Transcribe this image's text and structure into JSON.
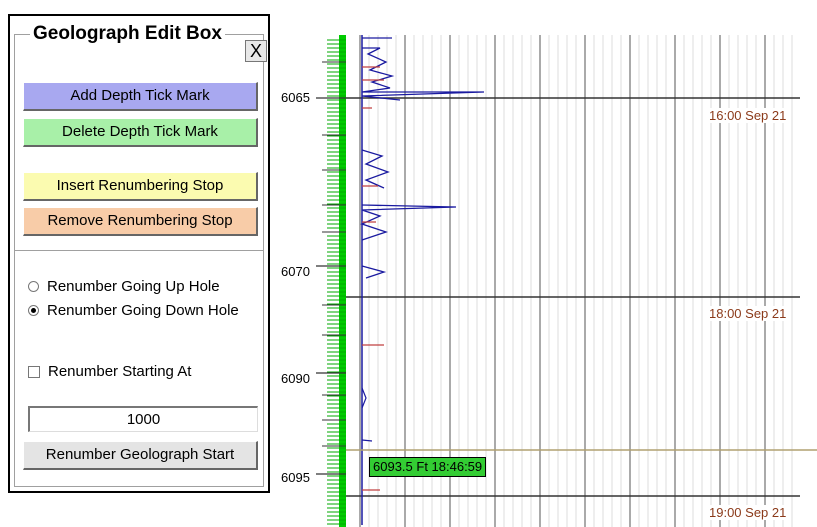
{
  "panel": {
    "title": "Geolograph Edit Box",
    "close_label": "X",
    "buttons": {
      "add_tick": "Add Depth Tick Mark",
      "delete_tick": "Delete Depth Tick Mark",
      "insert_stop": "Insert Renumbering Stop",
      "remove_stop": "Remove Renumbering Stop",
      "renumber_start": "Renumber Geolograph Start"
    },
    "button_colors": {
      "add_tick": "#a8a8f0",
      "delete_tick": "#a8f0a8",
      "insert_stop": "#fbfbb0",
      "remove_stop": "#f8cca8",
      "renumber_start": "#e4e4e4"
    },
    "options": {
      "up_hole": {
        "label": "Renumber Going Up Hole",
        "selected": false
      },
      "down_hole": {
        "label": "Renumber Going Down Hole",
        "selected": true
      },
      "starting_at": {
        "label": "Renumber Starting At",
        "checked": false
      }
    },
    "start_value": "1000"
  },
  "chart": {
    "depth_labels": [
      "6065",
      "6070",
      "6090",
      "6095"
    ],
    "time_labels": [
      "16:00 Sep 21",
      "18:00 Sep 21",
      "19:00 Sep 21"
    ],
    "cursor_readout": "6093.5 Ft 18:46:59",
    "colors": {
      "grid": "#c8c8c8",
      "trace": "#1a1aa0",
      "accent_trace": "#c04040",
      "track_bar": "#00cc00",
      "cursor_line": "#b0a070",
      "time_text": "#8b3a1a"
    }
  }
}
